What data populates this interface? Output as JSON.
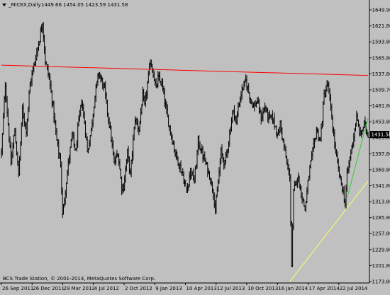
{
  "header": {
    "symbol_label": "_MICEX,Daily",
    "ohlc_label": "1449.66 1454.05 1423.59 1431.58"
  },
  "footer": {
    "copyright": "BCS Trade Station, © 2001-2014, MetaQuotes Software Corp."
  },
  "colors": {
    "background": "#c0c0c0",
    "plot_background": "#c0c0c0",
    "bars": "#000000",
    "resistance_line": "#ff0000",
    "support_line_long": "#ffff66",
    "support_line_short": "#33cc33",
    "price_tag_bg": "#000000",
    "price_tag_text": "#ffffff"
  },
  "chart_data": {
    "type": "ohlc",
    "x_tick_labels": [
      "26 Sep 2011",
      "26 Dec 2011",
      "29 Mar 2012",
      "4 Jul 2012",
      "2 Oct 2012",
      "9 Jan 2013",
      "10 Apr 2013",
      "12 Jul 2013",
      "10 Oct 2013",
      "16 Jan 2014",
      "17 Apr 2014",
      "22 Jul 2014"
    ],
    "y_tick_labels": [
      "1649.90",
      "1621.80",
      "1593.80",
      "1565.80",
      "1537.80",
      "1509.70",
      "1481.80",
      "1453.80",
      "1425.80",
      "1397.80",
      "1369.80",
      "1341.80",
      "1313.80",
      "1285.80",
      "1257.80",
      "1229.80",
      "1201.80",
      "1173.80"
    ],
    "ylim": [
      1173.8,
      1649.9
    ],
    "current_price": "1431.58",
    "price_path": [
      [
        0,
        1400
      ],
      [
        4,
        1520
      ],
      [
        10,
        1380
      ],
      [
        14,
        1440
      ],
      [
        18,
        1360
      ],
      [
        22,
        1475
      ],
      [
        26,
        1440
      ],
      [
        30,
        1520
      ],
      [
        35,
        1560
      ],
      [
        40,
        1600
      ],
      [
        43,
        1630
      ],
      [
        46,
        1560
      ],
      [
        50,
        1530
      ],
      [
        54,
        1480
      ],
      [
        58,
        1420
      ],
      [
        62,
        1380
      ],
      [
        64,
        1290
      ],
      [
        66,
        1320
      ],
      [
        70,
        1380
      ],
      [
        74,
        1430
      ],
      [
        78,
        1400
      ],
      [
        80,
        1440
      ],
      [
        84,
        1490
      ],
      [
        88,
        1440
      ],
      [
        90,
        1400
      ],
      [
        94,
        1440
      ],
      [
        98,
        1500
      ],
      [
        102,
        1540
      ],
      [
        105,
        1525
      ],
      [
        108,
        1510
      ],
      [
        112,
        1460
      ],
      [
        114,
        1440
      ],
      [
        118,
        1380
      ],
      [
        122,
        1400
      ],
      [
        126,
        1340
      ],
      [
        128,
        1340
      ],
      [
        132,
        1400
      ],
      [
        135,
        1360
      ],
      [
        138,
        1420
      ],
      [
        140,
        1460
      ],
      [
        144,
        1440
      ],
      [
        148,
        1500
      ],
      [
        150,
        1480
      ],
      [
        153,
        1520
      ],
      [
        156,
        1560
      ],
      [
        159,
        1540
      ],
      [
        162,
        1510
      ],
      [
        164,
        1530
      ],
      [
        168,
        1520
      ],
      [
        170,
        1500
      ],
      [
        174,
        1460
      ],
      [
        178,
        1430
      ],
      [
        182,
        1400
      ],
      [
        186,
        1380
      ],
      [
        190,
        1360
      ],
      [
        194,
        1330
      ],
      [
        198,
        1370
      ],
      [
        202,
        1350
      ],
      [
        204,
        1380
      ],
      [
        206,
        1420
      ],
      [
        210,
        1400
      ],
      [
        214,
        1380
      ],
      [
        218,
        1360
      ],
      [
        222,
        1330
      ],
      [
        224,
        1300
      ],
      [
        226,
        1330
      ],
      [
        230,
        1400
      ],
      [
        234,
        1380
      ],
      [
        238,
        1420
      ],
      [
        242,
        1470
      ],
      [
        244,
        1470
      ],
      [
        246,
        1450
      ],
      [
        248,
        1480
      ],
      [
        252,
        1510
      ],
      [
        256,
        1525
      ],
      [
        260,
        1500
      ],
      [
        264,
        1480
      ],
      [
        268,
        1490
      ],
      [
        272,
        1460
      ],
      [
        276,
        1480
      ],
      [
        280,
        1460
      ],
      [
        284,
        1460
      ],
      [
        288,
        1440
      ],
      [
        290,
        1430
      ],
      [
        292,
        1450
      ],
      [
        296,
        1410
      ],
      [
        300,
        1370
      ],
      [
        302,
        1360
      ],
      [
        304,
        1200
      ],
      [
        306,
        1330
      ],
      [
        310,
        1360
      ],
      [
        314,
        1330
      ],
      [
        318,
        1300
      ],
      [
        322,
        1360
      ],
      [
        326,
        1400
      ],
      [
        330,
        1440
      ],
      [
        334,
        1420
      ],
      [
        338,
        1500
      ],
      [
        342,
        1520
      ],
      [
        346,
        1460
      ],
      [
        350,
        1400
      ],
      [
        354,
        1360
      ],
      [
        358,
        1330
      ],
      [
        360,
        1310
      ],
      [
        362,
        1360
      ],
      [
        366,
        1400
      ],
      [
        370,
        1440
      ],
      [
        372,
        1460
      ],
      [
        376,
        1430
      ],
      [
        380,
        1450
      ],
      [
        384,
        1431.58
      ]
    ],
    "resistance_line": [
      [
        0,
        1553
      ],
      [
        384,
        1535
      ]
    ],
    "support_line_long": [
      [
        302,
        1173.8
      ],
      [
        384,
        1350
      ]
    ],
    "support_line_short": [
      [
        362,
        1320
      ],
      [
        384,
        1460
      ]
    ]
  }
}
